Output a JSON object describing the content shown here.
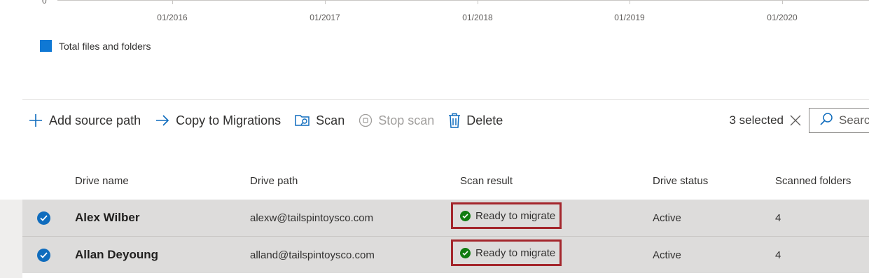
{
  "chart": {
    "y_axis_zero": "0",
    "x_ticks": [
      "01/2016",
      "01/2017",
      "01/2018",
      "01/2019",
      "01/2020"
    ],
    "legend_label": "Total files and folders",
    "legend_color": "#0f78d4"
  },
  "command_bar": {
    "add_source_path": "Add source path",
    "copy_to_migrations": "Copy to Migrations",
    "scan": "Scan",
    "stop_scan": "Stop scan",
    "delete": "Delete",
    "selected_count": "3 selected",
    "search_placeholder": "Search"
  },
  "table": {
    "columns": [
      "Drive name",
      "Drive path",
      "Scan result",
      "Drive status",
      "Scanned folders"
    ],
    "rows": [
      {
        "drive_name": "Alex Wilber",
        "drive_path": "alexw@tailspintoysco.com",
        "scan_result": "Ready to migrate",
        "drive_status": "Active",
        "scanned_folders": "4",
        "selected": true
      },
      {
        "drive_name": "Allan Deyoung",
        "drive_path": "alland@tailspintoysco.com",
        "scan_result": "Ready to migrate",
        "drive_status": "Active",
        "scanned_folders": "4",
        "selected": true
      }
    ]
  },
  "colors": {
    "accent": "#0f6cbd",
    "highlight_border": "#a4262c",
    "success": "#107c10",
    "selected_row": "#dddcdb"
  }
}
